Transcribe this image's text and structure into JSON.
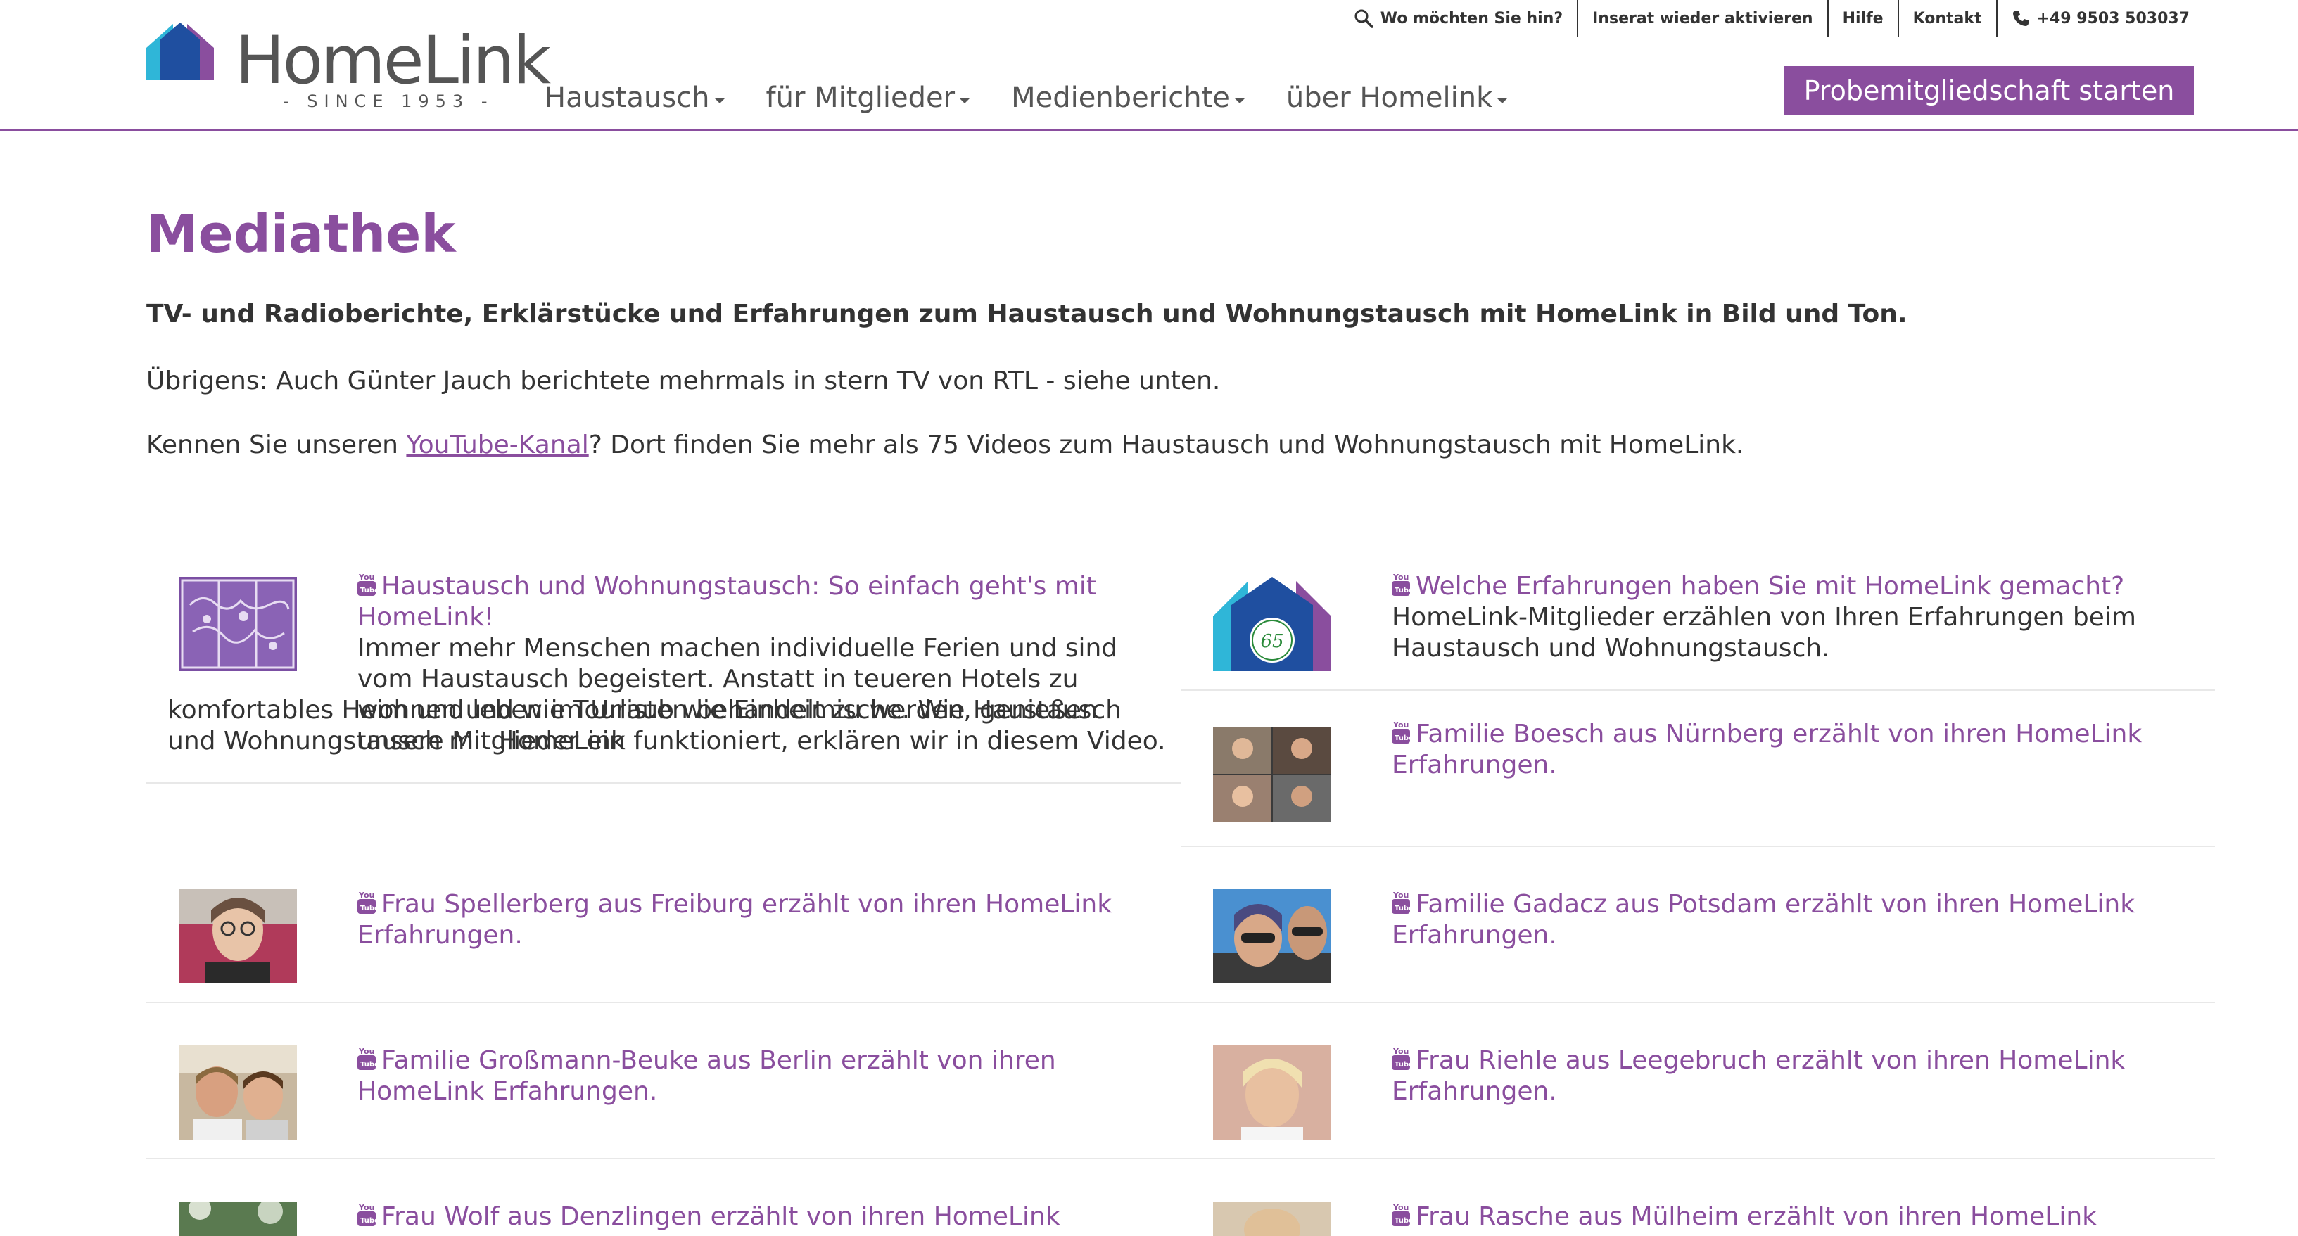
{
  "brand": {
    "name": "HomeLink",
    "since": "- SINCE 1953 -",
    "colors": {
      "accent": "#8a4e9e",
      "logo_blue": "#1f4fa0",
      "logo_cyan": "#2fb6d8",
      "logo_purple": "#8a4e9e"
    }
  },
  "topbar": {
    "search_label": "Wo möchten Sie hin?",
    "reactivate_label": "Inserat wieder aktivieren",
    "help_label": "Hilfe",
    "contact_label": "Kontakt",
    "phone_label": "+49 9503 503037"
  },
  "nav": {
    "items": [
      {
        "label": "Haustausch"
      },
      {
        "label": "für Mitglieder"
      },
      {
        "label": "Medienberichte"
      },
      {
        "label": "über Homelink"
      }
    ],
    "cta_label": "Probemitgliedschaft starten"
  },
  "page": {
    "title": "Mediathek",
    "lead": "TV- und Radioberichte, Erklärstücke und Erfahrungen zum Haustausch und Wohnungstausch mit HomeLink in Bild und Ton.",
    "note": "Übrigens: Auch Günter Jauch berichtete mehrmals in stern TV von RTL - siehe unten.",
    "youtube_prefix": "Kennen Sie unseren ",
    "youtube_link": "YouTube-Kanal",
    "youtube_suffix": "? Dort finden Sie mehr als 75 Videos zum Haustausch und Wohnungstausch mit HomeLink."
  },
  "media": [
    {
      "title": "Haustausch und Wohnungstausch: So einfach geht's mit HomeLink!",
      "desc_a": "Immer mehr Menschen machen individuelle Ferien und sind vom Haustausch begeistert. Anstatt in teueren Hotels zu wohnen und wie Touristen behandelt zu werden, genießen unsere Mitglieder ein",
      "desc_b": "komfortables Heim und leben im Urlaub wie Einheimische. Wie Haustausch und Wohnungstausch mit HomeLink funktioniert, erklären wir in diesem Video.",
      "thumb": "map-thumbnail"
    },
    {
      "title": "Welche Erfahrungen haben Sie mit HomeLink gemacht?",
      "desc": "HomeLink-Mitglieder erzählen von Ihren Erfahrungen beim Haustausch und Wohnungstausch.",
      "thumb": "anniversary-logo-thumbnail",
      "badge": "65"
    },
    {
      "title": "Familie Boesch aus Nürnberg erzählt von ihren HomeLink Erfahrungen.",
      "thumb": "family-grid-thumbnail"
    },
    {
      "title": "Frau Spellerberg aus Freiburg erzählt von ihren HomeLink Erfahrungen.",
      "thumb": "woman-glasses-thumbnail"
    },
    {
      "title": "Familie Gadacz aus Potsdam erzählt von ihren HomeLink Erfahrungen.",
      "thumb": "selfie-thumbnail"
    },
    {
      "title": "Familie Großmann-Beuke aus Berlin erzählt von ihren HomeLink Erfahrungen.",
      "thumb": "couple-thumbnail"
    },
    {
      "title": "Frau Riehle aus Leegebruch erzählt von ihren HomeLink Erfahrungen.",
      "thumb": "blonde-woman-thumbnail"
    },
    {
      "title": "Frau Wolf aus Denzlingen erzählt von ihren HomeLink Erfahrungen.",
      "thumb": "outdoor-thumbnail"
    },
    {
      "title": "Frau Rasche aus Mülheim erzählt von ihren HomeLink Erfahrungen.",
      "thumb": "portrait-thumbnail"
    }
  ],
  "icons": {
    "search": "search-icon",
    "phone": "phone-icon",
    "youtube": "youtube-icon",
    "caret": "caret-down-icon"
  }
}
